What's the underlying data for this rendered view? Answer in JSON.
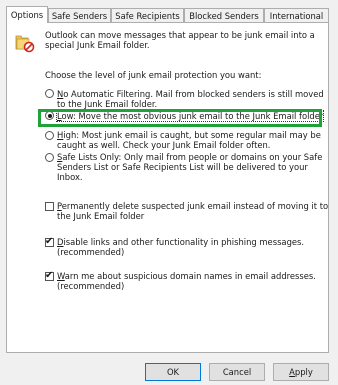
{
  "tabs": [
    "Options",
    "Safe Senders",
    "Safe Recipients",
    "Blocked Senders",
    "International"
  ],
  "intro": {
    "line1": "Outlook can move messages that appear to be junk email into a",
    "line2": "special Junk Email folder."
  },
  "level_prompt": "Choose the level of junk email protection you want:",
  "options": {
    "no_auto": {
      "key": "N",
      "line1": "o Automatic Filtering. Mail from blocked senders is still moved",
      "line2": "to the Junk Email folder."
    },
    "low": {
      "key": "L",
      "line1": "ow: Move the most obvious junk email to the Junk Email folder"
    },
    "high": {
      "key": "H",
      "line1": "igh: Most junk email is caught, but some regular mail may be",
      "line2": "caught as well. Check your Junk Email folder often."
    },
    "safe": {
      "key": "S",
      "line1": "afe Lists Only: Only mail from people or domains on your Safe",
      "line2": "Senders List or Safe Recipients List will be delivered to your",
      "line3": "Inbox."
    }
  },
  "checks": {
    "permanent": {
      "key": "P",
      "line1": "ermanently delete suspected junk email instead of moving it to",
      "line2": "the Junk Email folder",
      "checked": false
    },
    "disable_links": {
      "key": "D",
      "line1": "isable links and other functionality in phishing messages.",
      "line2": "(recommended)",
      "checked": true
    },
    "warn": {
      "key": "W",
      "line1": "arn me about suspicious domain names in email addresses.",
      "line2": "(recommended)",
      "checked": true
    }
  },
  "buttons": {
    "ok": "OK",
    "cancel": "Cancel",
    "apply_key": "A",
    "apply_rest": "pply"
  },
  "colors": {
    "highlight": "#21a13a",
    "default_button_border": "#0078d7"
  }
}
